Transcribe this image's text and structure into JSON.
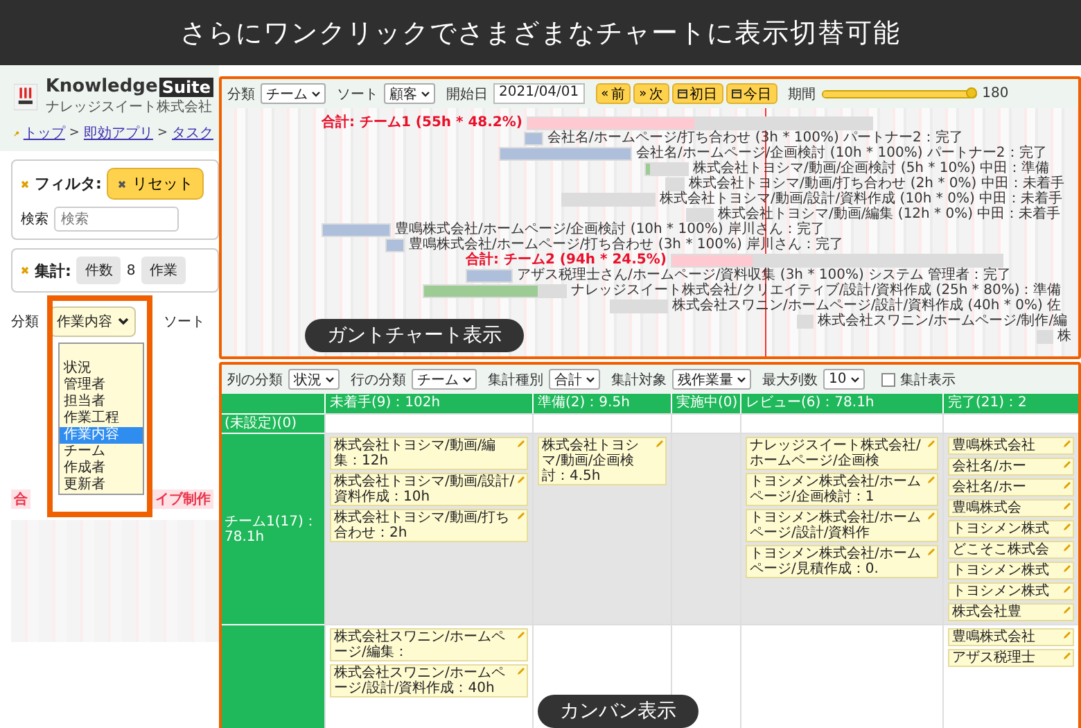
{
  "banner": {
    "title": "さらにワンクリックでさまざまなチャートに表示切替可能"
  },
  "app": {
    "logo": {
      "word": "Knowledge",
      "badge": "Suite",
      "company": "ナレッジスイート株式会社"
    },
    "breadcrumb": {
      "items": [
        "トップ",
        "即効アプリ",
        "タスク"
      ],
      "separator": ">"
    },
    "filter": {
      "label": "フィルタ:",
      "reset": "リセット",
      "search_label": "検索",
      "search_placeholder": "検索"
    },
    "summary": {
      "label": "集計:",
      "count_label": "件数",
      "count": "8",
      "next_label": "作業"
    },
    "group": {
      "label": "分類",
      "value": "作業内容",
      "next_label": "ソート",
      "open": true,
      "options": [
        {
          "label": "状況",
          "selected": false
        },
        {
          "label": "管理者",
          "selected": false
        },
        {
          "label": "担当者",
          "selected": false
        },
        {
          "label": "作業工程",
          "selected": false
        },
        {
          "label": "作業内容",
          "selected": true
        },
        {
          "label": "チーム",
          "selected": false
        },
        {
          "label": "作成者",
          "selected": false
        },
        {
          "label": "更新者",
          "selected": false
        }
      ]
    },
    "behind": {
      "left": "合",
      "right": "イブ制作"
    }
  },
  "gantt": {
    "badge": "ガントチャート表示",
    "toolbar": {
      "fields": [
        {
          "kind": "select",
          "label": "分類",
          "value": "チーム"
        },
        {
          "kind": "select",
          "label": "ソート",
          "value": "顧客"
        },
        {
          "kind": "input",
          "label": "開始日",
          "value": "2021/04/01"
        }
      ],
      "buttons": [
        {
          "kind": "arrows",
          "icon": "«",
          "label": "前"
        },
        {
          "kind": "arrows",
          "icon": "»",
          "label": "次"
        },
        {
          "kind": "calendar",
          "label": "初日"
        },
        {
          "kind": "calendar",
          "label": "今日"
        }
      ],
      "period": {
        "label": "期間",
        "level": 0.98,
        "reading": "180"
      }
    },
    "rows": [
      {
        "kind": "total",
        "label": "合計: チーム1 (55h * 48.2%)",
        "level": 0.482
      },
      {
        "kind": "task",
        "label": "会社名/ホームページ/打ち合わせ (3h * 100%) パートナー2：完了",
        "level": 1
      },
      {
        "kind": "task",
        "label": "会社名/ホームページ/企画検討 (10h * 100%) パートナー2：完了",
        "level": 1
      },
      {
        "kind": "task",
        "label": "株式会社トヨシマ/動画/企画検討 (5h * 10%) 中田：準備",
        "level": 0.1
      },
      {
        "kind": "task",
        "label": "株式会社トヨシマ/動画/打ち合わせ (2h * 0%) 中田：未着手"
      },
      {
        "kind": "task",
        "label": "株式会社トヨシマ/動画/設計/資料作成 (10h * 0%) 中田：未着手"
      },
      {
        "kind": "task",
        "label": "株式会社トヨシマ/動画/編集 (12h * 0%) 中田：未着手"
      },
      {
        "kind": "task",
        "label": "豊鳴株式会社/ホームページ/企画検討 (10h * 100%) 岸川さん：完了",
        "level": 1
      },
      {
        "kind": "task",
        "label": "豊鳴株式会社/ホームページ/打ち合わせ (3h * 100%) 岸川さん：完了",
        "level": 1
      },
      {
        "kind": "total",
        "label": "合計: チーム2 (94h * 24.5%)",
        "level": 0.245
      },
      {
        "kind": "task",
        "label": "アザス税理士さん/ホームページ/資料収集 (3h * 100%) システム 管理者：完了",
        "level": 1
      },
      {
        "kind": "task",
        "label": "ナレッジスイート株式会社/クリエイティブ/設計/資料作成 (25h * 80%)：準備",
        "level": 0.8
      },
      {
        "kind": "task",
        "label": "株式会社スワニン/ホームページ/設計/資料作成 (40h * 0%) 佐"
      },
      {
        "kind": "task",
        "label": "株式会社スワニン/ホームページ/制作/編"
      },
      {
        "kind": "task",
        "label": "株"
      }
    ]
  },
  "kanban": {
    "badge": "カンバン表示",
    "toolbar": {
      "selects": [
        {
          "label": "列の分類",
          "value": "状況"
        },
        {
          "label": "行の分類",
          "value": "チーム"
        },
        {
          "label": "集計種別",
          "value": "合計"
        },
        {
          "label": "集計対象",
          "value": "残作業量"
        },
        {
          "label": "最大列数",
          "value": "10"
        }
      ],
      "checkbox": {
        "label": "集計表示",
        "checked": false
      }
    },
    "columns": [
      "未着手(9)：102h",
      "準備(2)：9.5h",
      "実施中(0)",
      "レビュー(6)：78.1h",
      "完了(21)：2"
    ],
    "rows": [
      {
        "label": "(未設定)(0)",
        "cells": [
          {},
          {},
          {},
          {},
          {}
        ]
      },
      {
        "label": "チーム1(17)：78.1h",
        "cells": [
          {
            "cards": [
              "株式会社トヨシマ/動画/編集：12h",
              "株式会社トヨシマ/動画/設計/資料作成：10h",
              "株式会社トヨシマ/動画/打ち合わせ：2h"
            ]
          },
          {
            "cards": [
              "株式会社トヨシマ/動画/企画検討：4.5h"
            ]
          },
          {},
          {
            "cards": [
              "ナレッジスイート株式会社/ホームページ/企画検",
              "トヨシメン株式会社/ホームページ/企画検討：1",
              "トヨシメン株式会社/ホームページ/設計/資料作",
              "トヨシメン株式会社/ホームページ/見積作成：0."
            ]
          },
          {
            "cards": [
              "豊鳴株式会社",
              "会社名/ホー",
              "会社名/ホー",
              "豊鳴株式会",
              "トヨシメン株式",
              "どこそこ株式会",
              "トヨシメン株式",
              "トヨシメン株式",
              "株式会社豊"
            ]
          }
        ]
      },
      {
        "cells": [
          {
            "cards": [
              "株式会社スワニン/ホームページ/編集：",
              "株式会社スワニン/ホームページ/設計/資料作成：40h"
            ]
          },
          {},
          {},
          {},
          {
            "cards": [
              "豊鳴株式会社",
              "アザス税理士"
            ]
          }
        ]
      }
    ]
  }
}
